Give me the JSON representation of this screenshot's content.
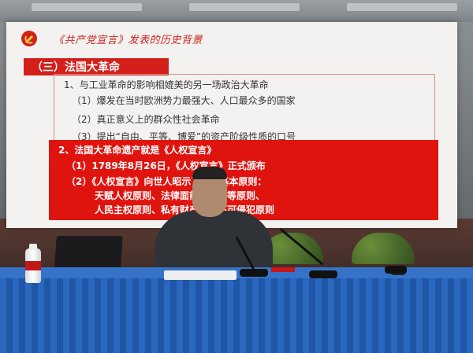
{
  "slide": {
    "title": "《共产党宣言》发表的历史背景",
    "section": "（三）法国大革命",
    "list": [
      "1、与工业革命的影响相媲美的另一场政治大革命",
      "（1）爆发在当时欧洲势力最强大、人口最众多的国家",
      "（2）真正意义上的群众性社会革命",
      "（3）提出“自由、平等、博爱”的资产阶级性质的口号"
    ],
    "highlight": [
      "2、法国大革命遗产就是《人权宣言》",
      "（1）1789年8月26日，《人权宣言》正式颁布",
      "（2）《人权宣言》向世人昭示了以下基本原则：",
      "天赋人权原则、法律面前人人平等原则、",
      "人民主权原则、私有财产神圣不可侵犯原则"
    ]
  },
  "colors": {
    "accent": "#d3201b",
    "highlight_bg": "#e0140f",
    "desk": "#2460b4"
  },
  "icons": {
    "party_emblem": "hammer-sickle-icon"
  }
}
